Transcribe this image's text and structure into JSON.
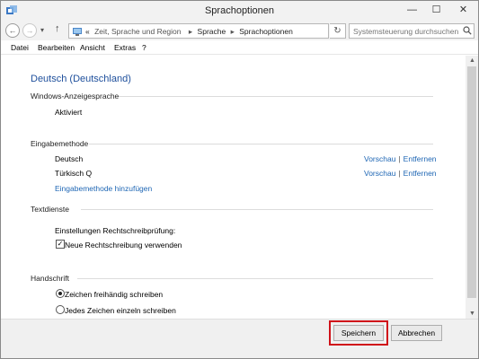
{
  "window": {
    "title": "Sprachoptionen",
    "min_glyph": "—",
    "max_glyph": "☐",
    "close_glyph": "✕"
  },
  "nav": {
    "back_glyph": "←",
    "forward_glyph": "→",
    "dropdown_glyph": "▾",
    "up_glyph": "↑",
    "breadcrumb_prefix": "«",
    "breadcrumb": [
      "Zeit, Sprache und Region",
      "Sprache",
      "Sprachoptionen"
    ],
    "breadcrumb_sep": "▸",
    "address_chevron": "▾",
    "refresh_glyph": "↻",
    "search_placeholder": "Systemsteuerung durchsuchen"
  },
  "menu": [
    "Datei",
    "Bearbeiten",
    "Ansicht",
    "Extras",
    "?"
  ],
  "page": {
    "title": "Deutsch (Deutschland)",
    "display_language": {
      "header": "Windows-Anzeigesprache",
      "status": "Aktiviert"
    },
    "input_methods": {
      "header": "Eingabemethode",
      "items": [
        {
          "name": "Deutsch",
          "preview": "Vorschau",
          "remove": "Entfernen"
        },
        {
          "name": "Türkisch Q",
          "preview": "Vorschau",
          "remove": "Entfernen"
        }
      ],
      "separator": "|",
      "add_link": "Eingabemethode hinzufügen"
    },
    "text_services": {
      "header": "Textdienste",
      "spellcheck_label": "Einstellungen Rechtschreibprüfung:",
      "new_spelling_label": "Neue Rechtschreibung verwenden",
      "new_spelling_checked": true,
      "check_glyph": "✓"
    },
    "handwriting": {
      "header": "Handschrift",
      "options": [
        {
          "label": "Zeichen freihändig schreiben",
          "selected": true
        },
        {
          "label": "Jedes Zeichen einzeln schreiben",
          "selected": false
        }
      ]
    }
  },
  "footer": {
    "save": "Speichern",
    "cancel": "Abbrechen"
  },
  "colors": {
    "link": "#1e66b4",
    "title": "#1e4f9c",
    "highlight": "#d0121a"
  },
  "scrollbar": {
    "up_glyph": "▲",
    "down_glyph": "▼"
  }
}
